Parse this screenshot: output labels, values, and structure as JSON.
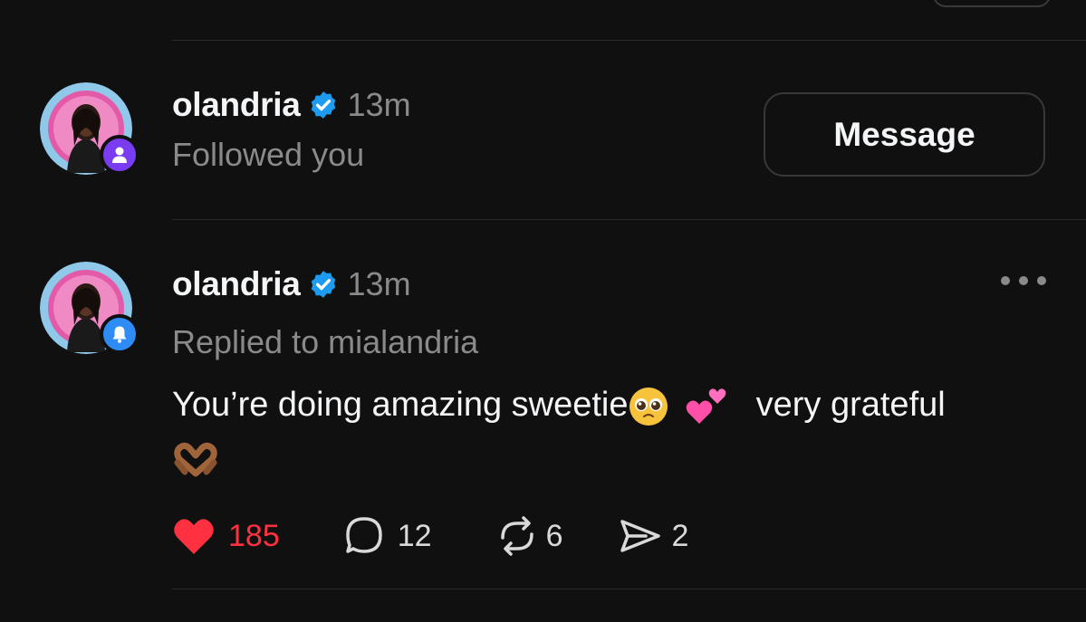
{
  "notifications": [
    {
      "username": "olandria",
      "verified": true,
      "time": "13m",
      "activity": "Followed you",
      "badge_icon": "person-icon",
      "badge_color": "#7a3cf0",
      "action_button": "Message"
    },
    {
      "username": "olandria",
      "verified": true,
      "time": "13m",
      "activity": "Replied to mialandria",
      "badge_icon": "bell-icon",
      "badge_color": "#2f8cf5",
      "reply_text": "You’re doing amazing sweetie",
      "reply_text_end": "very grateful",
      "emojis": [
        "pleading-face-emoji",
        "two-hearts-emoji",
        "heart-hands-emoji"
      ],
      "stats": {
        "likes": "185",
        "comments": "12",
        "reposts": "6",
        "shares": "2"
      },
      "liked": true
    }
  ],
  "colors": {
    "background": "#101010",
    "like": "#ff3040",
    "verified": "#1d9bf0",
    "muted_text": "#8a8a8a"
  }
}
